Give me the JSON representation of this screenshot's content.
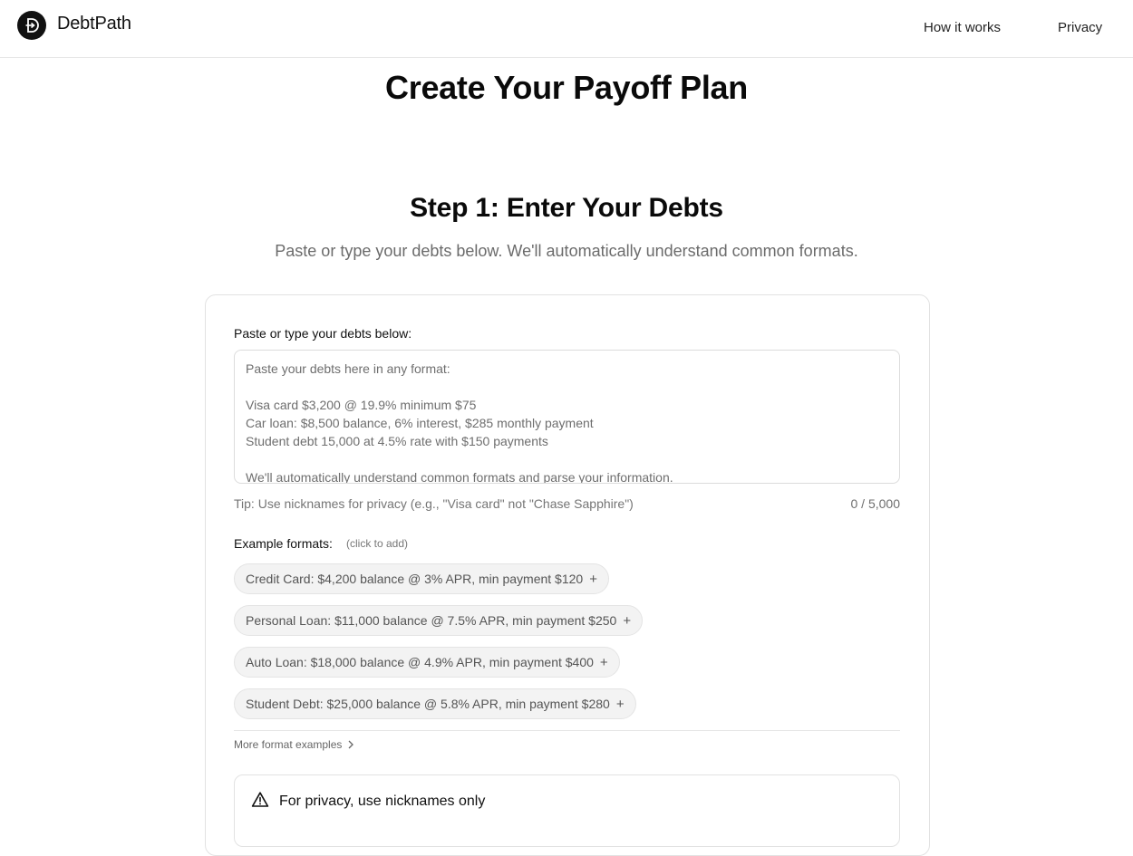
{
  "header": {
    "brand": "DebtPath",
    "logo_icon": "debtpath-logo-icon",
    "nav": {
      "how_it_works": "How it works",
      "privacy": "Privacy"
    }
  },
  "page": {
    "title": "Create Your Payoff Plan"
  },
  "step1": {
    "title": "Step 1: Enter Your Debts",
    "subtitle": "Paste or type your debts below. We'll automatically understand common formats.",
    "input": {
      "label": "Paste or type your debts below:",
      "value": "",
      "placeholder": "Paste your debts here in any format:\n\nVisa card $3,200 @ 19.9% minimum $75\nCar loan: $8,500 balance, 6% interest, $285 monthly payment\nStudent debt 15,000 at 4.5% rate with $150 payments\n\nWe'll automatically understand common formats and parse your information.",
      "tip": "Tip: Use nicknames for privacy (e.g., \"Visa card\" not \"Chase Sapphire\")",
      "counter": "0 / 5,000"
    },
    "examples": {
      "label": "Example formats:",
      "hint": "(click to add)",
      "items": [
        "Credit Card: $4,200 balance @ 3% APR, min payment $120",
        "Personal Loan: $11,000 balance @ 7.5% APR, min payment $250",
        "Auto Loan: $18,000 balance @ 4.9% APR, min payment $400",
        "Student Debt: $25,000 balance @ 5.8% APR, min payment $280"
      ],
      "add_symbol": "+",
      "more_label": "More format examples"
    },
    "privacy_alert": {
      "title": "For privacy, use nicknames only",
      "icon": "warning-triangle-icon"
    }
  }
}
